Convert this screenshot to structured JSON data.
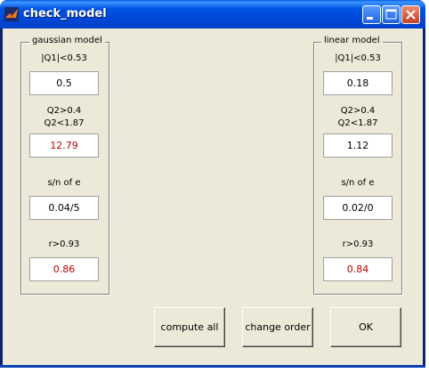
{
  "window": {
    "title": "check_model"
  },
  "gaussian": {
    "title": "gaussian model",
    "q1_label": "|Q1|<0.53",
    "q1_value": "0.5",
    "q2_label_1": "Q2>0.4",
    "q2_label_2": "Q2<1.87",
    "q2_value": "12.79",
    "sn_label": "s/n of e",
    "sn_value": "0.04/5",
    "r_label": "r>0.93",
    "r_value": "0.86"
  },
  "linear": {
    "title": "linear model",
    "q1_label": "|Q1|<0.53",
    "q1_value": "0.18",
    "q2_label_1": "Q2>0.4",
    "q2_label_2": "Q2<1.87",
    "q2_value": "1.12",
    "sn_label": "s/n of e",
    "sn_value": "0.02/0",
    "r_label": "r>0.93",
    "r_value": "0.84"
  },
  "buttons": {
    "compute_all": "compute all",
    "change_order": "change order",
    "ok": "OK"
  },
  "colors": {
    "warning_text": "#c00000"
  }
}
